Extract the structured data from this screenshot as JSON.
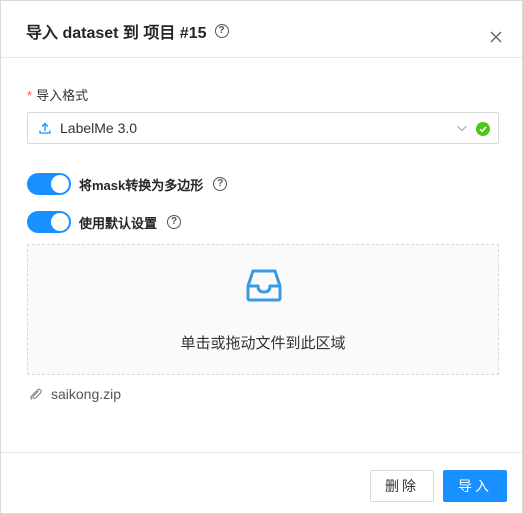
{
  "dialog": {
    "title": "导入 dataset 到 项目 #15",
    "help_glyph": "?",
    "close_icon": "close-icon"
  },
  "form": {
    "format_label": "导入格式",
    "required_mark": "*",
    "format_value": "LabelMe 3.0",
    "format_valid": true
  },
  "switches": [
    {
      "label": "将mask转换为多边形",
      "checked": true
    },
    {
      "label": "使用默认设置",
      "checked": true
    }
  ],
  "dropzone": {
    "text": "单击或拖动文件到此区域",
    "icon": "inbox-icon"
  },
  "file": {
    "name": "saikong.zip",
    "icon": "paperclip-icon"
  },
  "footer": {
    "delete_label": "删除",
    "import_label": "导入"
  },
  "colors": {
    "primary": "#1890ff",
    "success": "#52c41a",
    "required": "#ff4d4f"
  }
}
